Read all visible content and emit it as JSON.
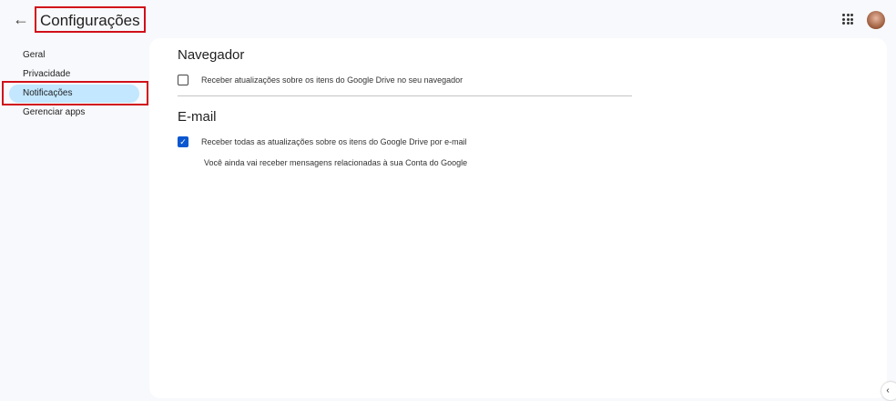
{
  "header": {
    "title": "Configurações"
  },
  "sidebar": {
    "items": [
      {
        "label": "Geral"
      },
      {
        "label": "Privacidade"
      },
      {
        "label": "Notificações"
      },
      {
        "label": "Gerenciar apps"
      }
    ]
  },
  "main": {
    "browser": {
      "heading": "Navegador",
      "option": "Receber atualizações sobre os itens do Google Drive no seu navegador",
      "checked": false
    },
    "email": {
      "heading": "E-mail",
      "option": "Receber todas as atualizações sobre os itens do Google Drive por e-mail",
      "checked": true,
      "note": "Você ainda vai receber mensagens relacionadas à sua Conta do Google"
    }
  }
}
